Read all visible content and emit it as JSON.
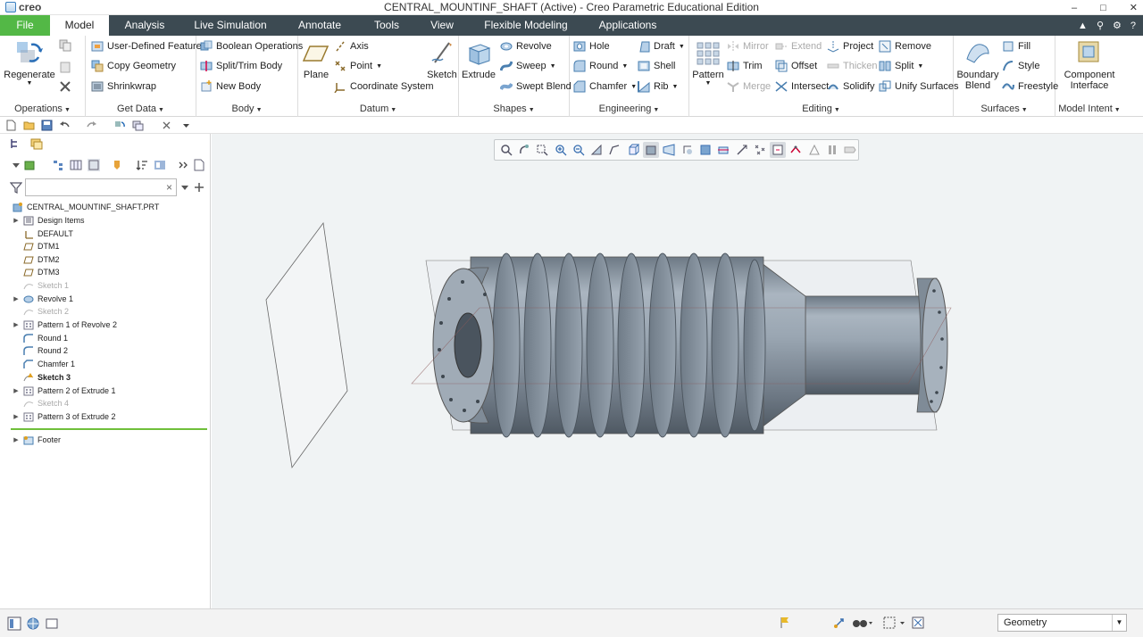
{
  "app": {
    "logo_text": "creo",
    "title": "CENTRAL_MOUNTINF_SHAFT (Active) - Creo Parametric Educational Edition",
    "window_controls": [
      "–",
      "□",
      "✕"
    ]
  },
  "tabs": [
    {
      "label": "File"
    },
    {
      "label": "Model"
    },
    {
      "label": "Analysis"
    },
    {
      "label": "Live Simulation"
    },
    {
      "label": "Annotate"
    },
    {
      "label": "Tools"
    },
    {
      "label": "View"
    },
    {
      "label": "Flexible Modeling"
    },
    {
      "label": "Applications"
    }
  ],
  "ribbon": {
    "operations": {
      "label": "Operations",
      "regenerate": "Regenerate"
    },
    "getdata": {
      "label": "Get Data",
      "udf": "User-Defined Feature",
      "copy_geometry": "Copy Geometry",
      "shrinkwrap": "Shrinkwrap"
    },
    "body": {
      "label": "Body",
      "boolean": "Boolean Operations",
      "split_trim": "Split/Trim Body",
      "new_body": "New Body"
    },
    "datum": {
      "label": "Datum",
      "plane": "Plane",
      "axis": "Axis",
      "point": "Point",
      "coord_sys": "Coordinate System",
      "sketch": "Sketch"
    },
    "shapes": {
      "label": "Shapes",
      "extrude": "Extrude",
      "revolve": "Revolve",
      "sweep": "Sweep",
      "swept_blend": "Swept Blend"
    },
    "engineering": {
      "label": "Engineering",
      "hole": "Hole",
      "round": "Round",
      "chamfer": "Chamfer",
      "draft": "Draft",
      "shell": "Shell",
      "rib": "Rib"
    },
    "editing": {
      "label": "Editing",
      "pattern": "Pattern",
      "mirror": "Mirror",
      "trim": "Trim",
      "merge": "Merge",
      "extend": "Extend",
      "offset": "Offset",
      "intersect": "Intersect",
      "project": "Project",
      "thicken": "Thicken",
      "solidify": "Solidify",
      "remove": "Remove",
      "split": "Split",
      "unify_surfaces": "Unify Surfaces"
    },
    "surfaces": {
      "label": "Surfaces",
      "boundary_blend_1": "Boundary",
      "boundary_blend_2": "Blend",
      "fill": "Fill",
      "style": "Style",
      "freestyle": "Freestyle"
    },
    "model_intent": {
      "label": "Model Intent",
      "component_1": "Component",
      "component_2": "Interface"
    }
  },
  "model_tree": {
    "filter_placeholder": "",
    "items": [
      {
        "label": "CENTRAL_MOUNTINF_SHAFT.PRT"
      },
      {
        "label": "Design Items"
      },
      {
        "label": "DEFAULT"
      },
      {
        "label": "DTM1"
      },
      {
        "label": "DTM2"
      },
      {
        "label": "DTM3"
      },
      {
        "label": "Sketch 1"
      },
      {
        "label": "Revolve 1"
      },
      {
        "label": "Sketch 2"
      },
      {
        "label": "Pattern 1 of Revolve 2"
      },
      {
        "label": "Round 1"
      },
      {
        "label": "Round 2"
      },
      {
        "label": "Chamfer 1"
      },
      {
        "label": "Sketch 3"
      },
      {
        "label": "Pattern 2 of Extrude 1"
      },
      {
        "label": "Sketch 4"
      },
      {
        "label": "Pattern 3 of Extrude 2"
      },
      {
        "label": "Footer"
      }
    ]
  },
  "status": {
    "selection_filter": "Geometry"
  },
  "colors": {
    "tabbar": "#3c4a52",
    "file_tab": "#53b846",
    "accent": "#6fbf3a",
    "part": "#8e9aa6"
  }
}
